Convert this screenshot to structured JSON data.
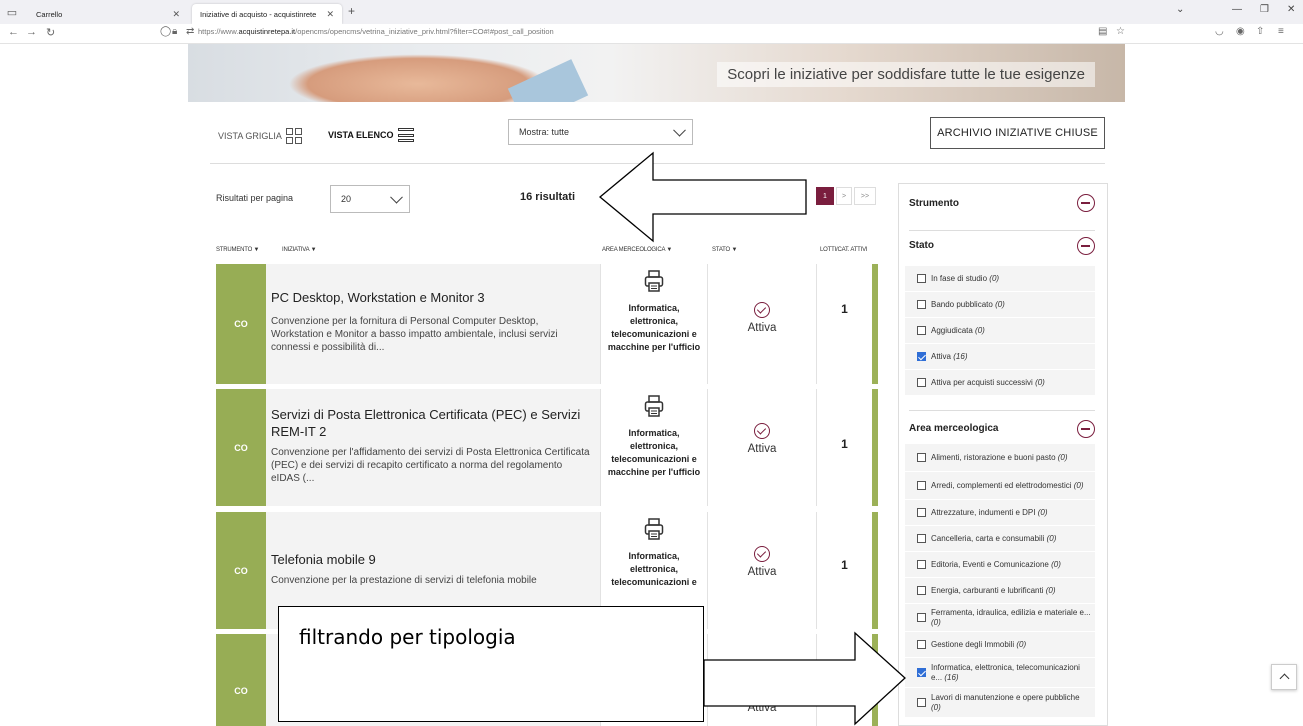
{
  "browser": {
    "tabs": [
      {
        "label": "Carrello"
      },
      {
        "label": "Iniziative di acquisto - acquistinrete"
      }
    ],
    "url_prefix": "https://www.",
    "url_domain": "acquistinretepa.it",
    "url_path": "/opencms/opencms/vetrina_iniziative_priv.html?filter=CO#!#post_call_position"
  },
  "banner": {
    "text": "Scopri le iniziative per soddisfare tutte le tue esigenze"
  },
  "toolbar": {
    "vista_griglia": "VISTA GRIGLIA",
    "vista_elenco": "VISTA ELENCO",
    "mostra": "Mostra: tutte",
    "archive": "ARCHIVIO INIZIATIVE CHIUSE",
    "results_per_page_label": "Risultati per pagina",
    "results_per_page_value": "20",
    "results_count": "16 risultati"
  },
  "pagination": {
    "current": "1",
    "next": ">",
    "last": ">>"
  },
  "columns": {
    "strumento": "STRUMENTO ▼",
    "iniziativa": "INIZIATIVA ▼",
    "area": "AREA MERCEOLOGICA ▼",
    "stato": "STATO ▼",
    "lotti": "LOTTI/CAT. ATTIVI"
  },
  "rows": [
    {
      "strumento": "CO",
      "title": "PC Desktop, Workstation e Monitor 3",
      "desc": "Convenzione per la fornitura di Personal Computer Desktop, Workstation e Monitor a basso impatto ambientale, inclusi servizi connessi e possibilità di...",
      "area": "Informatica, elettronica, telecomunicazioni e macchine per l'ufficio",
      "stato": "Attiva",
      "lotti": "1"
    },
    {
      "strumento": "CO",
      "title": "Servizi di Posta Elettronica Certificata (PEC) e Servizi REM-IT 2",
      "desc": "Convenzione per l'affidamento dei servizi di Posta Elettronica Certificata (PEC) e dei servizi di recapito certificato a norma del regolamento eIDAS (...",
      "area": "Informatica, elettronica, telecomunicazioni e macchine per l'ufficio",
      "stato": "Attiva",
      "lotti": "1"
    },
    {
      "strumento": "CO",
      "title": "Telefonia mobile 9",
      "desc": "Convenzione per la prestazione di servizi di telefonia mobile",
      "area": "Informatica, elettronica, telecomunicazioni e",
      "stato": "Attiva",
      "lotti": "1"
    },
    {
      "strumento": "CO",
      "stato": "Attiva"
    }
  ],
  "sidebar": {
    "strumento": "Strumento",
    "stato": {
      "label": "Stato",
      "options": [
        {
          "label": "In fase di studio",
          "count": "(0)",
          "checked": false
        },
        {
          "label": "Bando pubblicato",
          "count": "(0)",
          "checked": false
        },
        {
          "label": "Aggiudicata",
          "count": "(0)",
          "checked": false
        },
        {
          "label": "Attiva",
          "count": "(16)",
          "checked": true
        },
        {
          "label": "Attiva per acquisti successivi",
          "count": "(0)",
          "checked": false
        }
      ]
    },
    "area": {
      "label": "Area merceologica",
      "options": [
        {
          "label": "Alimenti, ristorazione e buoni pasto",
          "count": "(0)",
          "checked": false
        },
        {
          "label": "Arredi, complementi ed elettrodomestici",
          "count": "(0)",
          "checked": false
        },
        {
          "label": "Attrezzature, indumenti e DPI",
          "count": "(0)",
          "checked": false
        },
        {
          "label": "Cancelleria, carta e consumabili",
          "count": "(0)",
          "checked": false
        },
        {
          "label": "Editoria, Eventi e Comunicazione",
          "count": "(0)",
          "checked": false
        },
        {
          "label": "Energia, carburanti e lubrificanti",
          "count": "(0)",
          "checked": false
        },
        {
          "label": "Ferramenta, idraulica, edilizia e materiale e...",
          "count": "(0)",
          "checked": false
        },
        {
          "label": "Gestione degli Immobili",
          "count": "(0)",
          "checked": false
        },
        {
          "label": "Informatica, elettronica, telecomunicazioni e...",
          "count": "(16)",
          "checked": true
        },
        {
          "label": "Lavori di manutenzione e opere pubbliche",
          "count": "(0)",
          "checked": false
        }
      ]
    }
  },
  "annotation": {
    "text": "filtrando per tipologia"
  },
  "colors": {
    "accent": "#7a1e3e",
    "strumento_green": "#97ad55",
    "checkbox_blue": "#2f6ed6"
  }
}
